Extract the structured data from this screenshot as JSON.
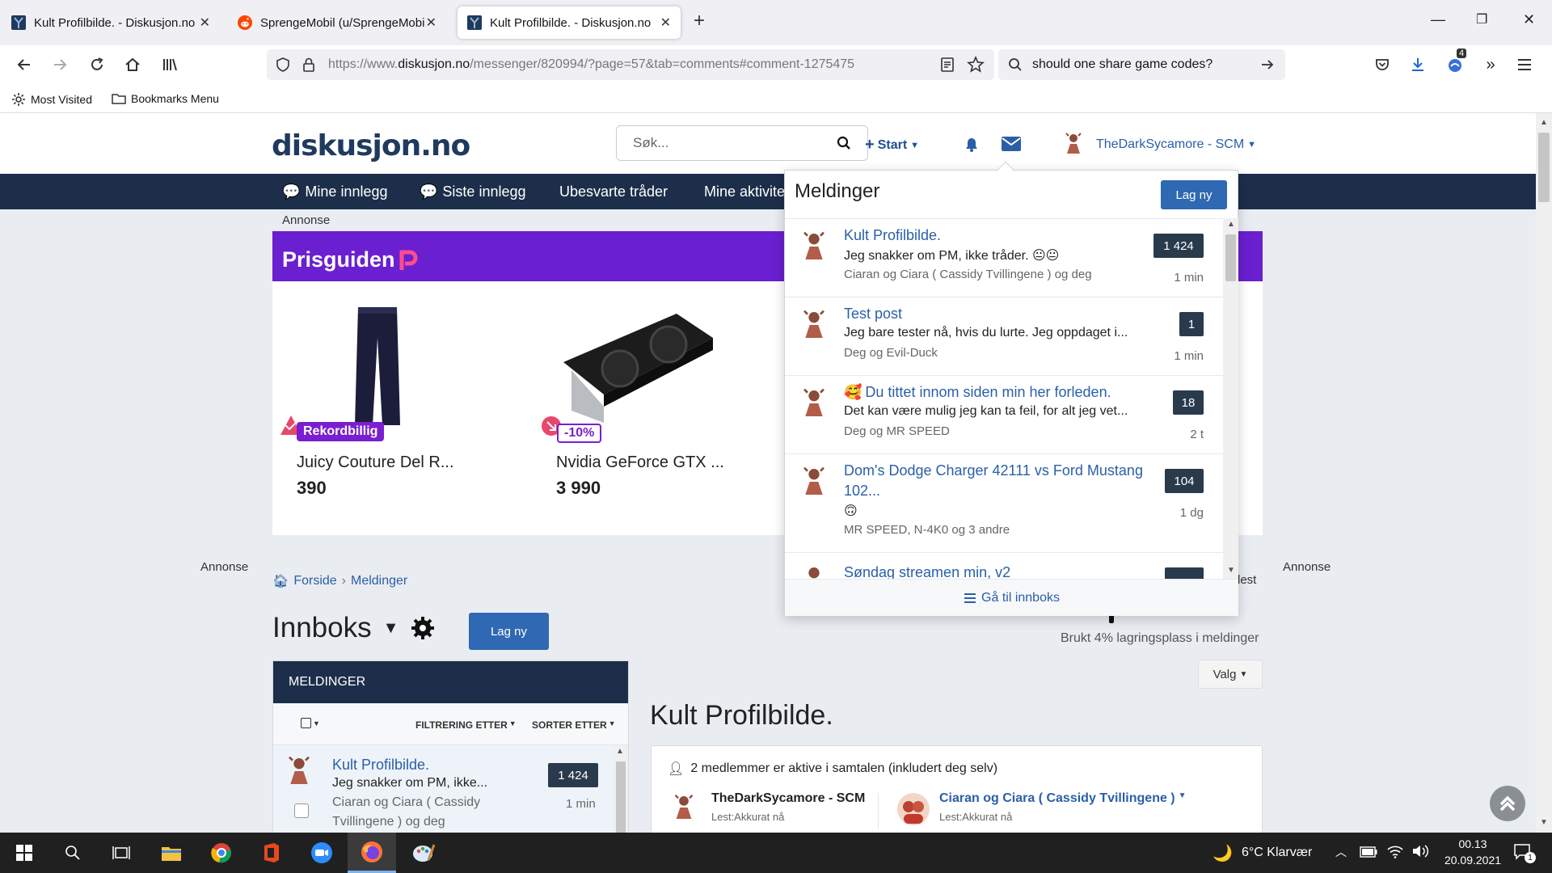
{
  "browser": {
    "tabs": [
      {
        "title": "Kult Profilbilde. - Diskusjon.no",
        "favicon": "diskusjon-favicon",
        "active": false
      },
      {
        "title": "SprengeMobil (u/SprengeMobi",
        "favicon": "reddit-favicon",
        "active": false
      },
      {
        "title": "Kult Profilbilde. - Diskusjon.no",
        "favicon": "diskusjon-favicon",
        "active": true
      }
    ],
    "new_tab": "+",
    "url_prefix": "https://www.",
    "url_domain": "diskusjon.no",
    "url_rest": "/messenger/820994/?page=57&tab=comments#comment-1275475",
    "search_query": "should one share game codes?",
    "extension_badge": "4",
    "bookmarks": [
      "Most Visited",
      "Bookmarks Menu"
    ]
  },
  "site": {
    "logo": "diskusjon.no",
    "search_placeholder": "Søk...",
    "start_label": "Start",
    "username": "TheDarkSycamore - SCM",
    "menu": [
      "Mine innlegg",
      "Siste innlegg",
      "Ubesvarte tråder",
      "Mine aktivite"
    ]
  },
  "ad": {
    "label": "Annonse",
    "brand": "Prisguiden",
    "products": [
      {
        "badge": "Rekordbillig",
        "name": "Juicy Couture Del R...",
        "price": "390"
      },
      {
        "badge": "-10%",
        "name": "Nvidia GeForce GTX ...",
        "price": "3 990"
      }
    ]
  },
  "side_ads": {
    "left": "Annonse",
    "right": "Annonse"
  },
  "breadcrumb": {
    "home": "Forside",
    "current": "Meldinger"
  },
  "inbox": {
    "title": "Innboks",
    "new_button": "Lag ny",
    "storage_text": "Brukt 4% lagringsplass i meldinger",
    "storage_percent": 4,
    "mark_read_fragment": "lest",
    "valg_label": "Valg",
    "panel_title": "MELDINGER",
    "filter_label": "FILTRERING ETTER",
    "sort_label": "SORTER ETTER",
    "first_item": {
      "title": "Kult Profilbilde.",
      "text": "Jeg snakker om PM, ikke...",
      "meta_line1": "Ciaran og Ciara ( Cassidy",
      "meta_line2": "Tvillingene ) og deg",
      "count": "1 424",
      "time": "1 min"
    }
  },
  "conversation": {
    "title": "Kult Profilbilde.",
    "active_members": "2 medlemmer er aktive i samtalen (inkludert deg selv)",
    "members": [
      {
        "name": "TheDarkSycamore - SCM",
        "status": "Lest:Akkurat nå"
      },
      {
        "name": "Ciaran og Ciara ( Cassidy Tvillingene )",
        "status": "Lest:Akkurat nå"
      }
    ]
  },
  "dropdown": {
    "title": "Meldinger",
    "new_button": "Lag ny",
    "items": [
      {
        "title": "Kult Profilbilde.",
        "text": "Jeg snakker om PM, ikke tråder. 😐😐",
        "meta": "Ciaran og Ciara ( Cassidy Tvillingene ) og deg",
        "count": "1 424",
        "time": "1 min"
      },
      {
        "title": "Test post",
        "text": "Jeg bare tester nå, hvis du lurte. Jeg oppdaget i...",
        "meta": "Deg og Evil-Duck",
        "count": "1",
        "time": "1 min"
      },
      {
        "title": "Du tittet innom siden min her forleden.",
        "title_emoji": "🥰",
        "text": "Det kan være mulig jeg kan ta feil, for alt jeg vet...",
        "meta": "Deg og MR SPEED",
        "count": "18",
        "time": "2 t"
      },
      {
        "title_line1": "Dom's Dodge Charger 42111 vs Ford Mustang",
        "title_line2": "102...",
        "text": "🙃",
        "meta": "MR SPEED, N-4K0 og 3 andre",
        "count": "104",
        "time": "1 dg"
      },
      {
        "title": "Søndag streamen min, v2"
      }
    ],
    "footer": "Gå til innboks"
  },
  "taskbar": {
    "weather": "6°C  Klarvær",
    "time": "00.13",
    "date": "20.09.2021",
    "notification_count": "1"
  },
  "colors": {
    "navy": "#1c2e4a",
    "link_blue": "#2a5fa8",
    "button_blue": "#2f68b3",
    "prisguiden_purple": "#6a1fd0"
  }
}
